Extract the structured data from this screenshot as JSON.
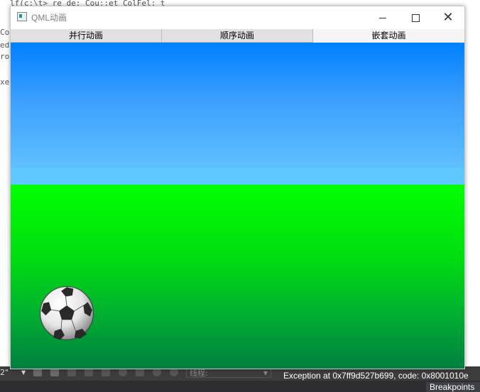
{
  "background": {
    "code_fragments": [
      "Co",
      "ed",
      "ro",
      "xe"
    ],
    "top_code": "lf(c:\\t> re de: Cou::et ColFel: t",
    "toolbar": {
      "config_select": "2\"",
      "thread_label": "线程:",
      "status_message": "Exception at 0x7ff9d527b699, code: 0x8001010e"
    },
    "breakpoints_tab": "Breakpoints"
  },
  "window": {
    "title": "QML动画",
    "icon": "app-window-icon",
    "controls": {
      "minimize": "minimize-icon",
      "maximize": "maximize-icon",
      "close": "close-icon"
    }
  },
  "tabs": [
    {
      "label": "并行动画",
      "active": false
    },
    {
      "label": "顺序动画",
      "active": false
    },
    {
      "label": "嵌套动画",
      "active": true
    }
  ],
  "scene": {
    "sky_colors": [
      "#0080ff",
      "#5ec8ff"
    ],
    "ground_colors": [
      "#00ff00",
      "#008040"
    ],
    "ball": "soccer-ball"
  }
}
